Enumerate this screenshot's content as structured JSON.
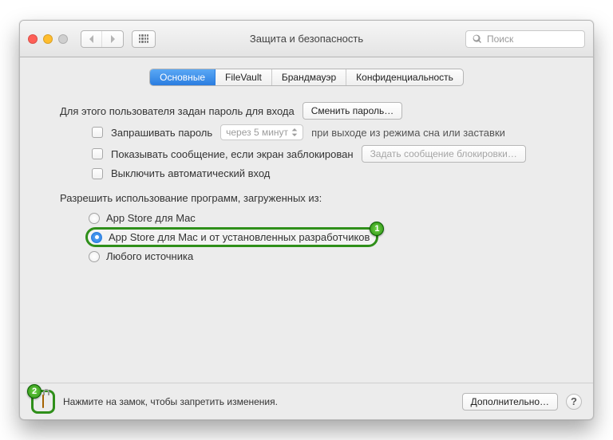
{
  "window": {
    "title": "Защита и безопасность",
    "search_placeholder": "Поиск"
  },
  "tabs": {
    "items": [
      "Основные",
      "FileVault",
      "Брандмауэр",
      "Конфиденциальность"
    ],
    "active_index": 0
  },
  "general": {
    "password_set_label": "Для этого пользователя задан пароль для входа",
    "change_password_btn": "Сменить пароль…",
    "require_password_label": "Запрашивать пароль",
    "delay_value": "через 5 минут",
    "require_password_after": "при выходе из режима сна или заставки",
    "show_message_label": "Показывать сообщение, если экран заблокирован",
    "set_lock_message_btn": "Задать сообщение блокировки…",
    "disable_autologin_label": "Выключить автоматический вход",
    "allow_apps_label": "Разрешить использование программ, загруженных из:",
    "sources": {
      "app_store": "App Store для Mac",
      "identified": "App Store для Mac и от установленных разработчиков",
      "anywhere": "Любого источника"
    },
    "selected_source": "identified"
  },
  "footer": {
    "lock_text": "Нажмите на замок, чтобы запретить изменения.",
    "advanced_btn": "Дополнительно…",
    "help": "?"
  },
  "annotations": {
    "callout1": "1",
    "callout2": "2"
  }
}
